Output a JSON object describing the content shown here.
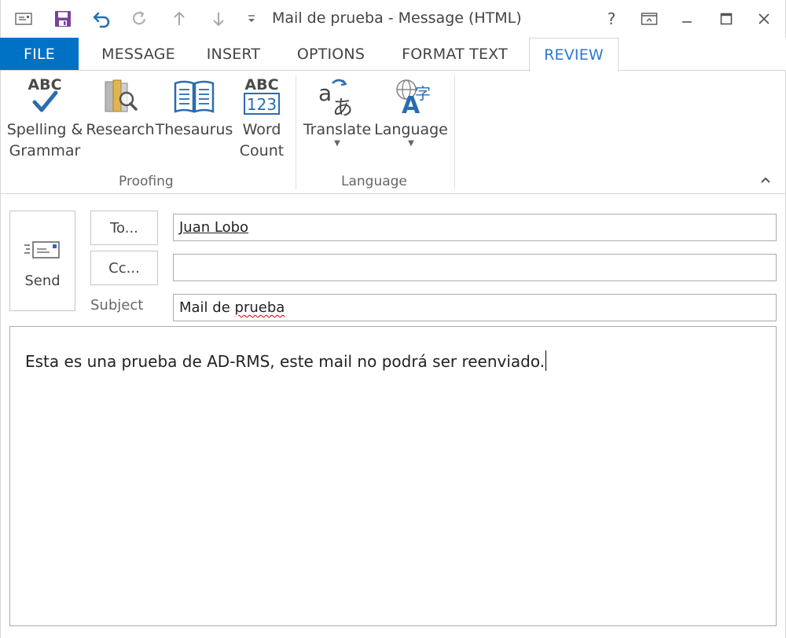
{
  "window": {
    "title": "Mail de prueba - Message (HTML)",
    "controls": {
      "help": "?",
      "restore_ribbon": "ribbon-display-icon",
      "minimize": "minimize-icon",
      "maximize": "maximize-icon",
      "close": "close-icon"
    }
  },
  "quick_access": [
    {
      "name": "message-icon"
    },
    {
      "name": "save-icon"
    },
    {
      "name": "undo-icon"
    },
    {
      "name": "redo-icon"
    },
    {
      "name": "previous-item-icon"
    },
    {
      "name": "next-item-icon"
    },
    {
      "name": "customize-qat-icon"
    }
  ],
  "tabs": {
    "file": "FILE",
    "message": "MESSAGE",
    "insert": "INSERT",
    "options": "OPTIONS",
    "format_text": "FORMAT TEXT",
    "review": "REVIEW",
    "active": "REVIEW"
  },
  "ribbon": {
    "proofing": {
      "label": "Proofing",
      "spelling": {
        "label": "Spelling &\nGrammar",
        "icon_text": "ABC"
      },
      "research": {
        "label": "Research"
      },
      "thesaurus": {
        "label": "Thesaurus"
      },
      "word_count": {
        "label": "Word\nCount",
        "icon_text_top": "ABC",
        "icon_text_bottom": "123"
      }
    },
    "language": {
      "label": "Language",
      "translate": {
        "label": "Translate"
      },
      "language": {
        "label": "Language"
      }
    }
  },
  "compose": {
    "send_label": "Send",
    "to_label": "To...",
    "cc_label": "Cc...",
    "subject_label": "Subject",
    "to_value": "Juan Lobo",
    "cc_value": "",
    "subject_prefix": "Mail de ",
    "subject_misspelled": "prueba",
    "body": "Esta es una prueba de AD-RMS, este mail no podrá ser reenviado."
  },
  "colors": {
    "accent": "#0072c6",
    "active_tab_text": "#2b79d0",
    "save_icon": "#7b3f9e",
    "undo_icon": "#2b6cb0"
  }
}
